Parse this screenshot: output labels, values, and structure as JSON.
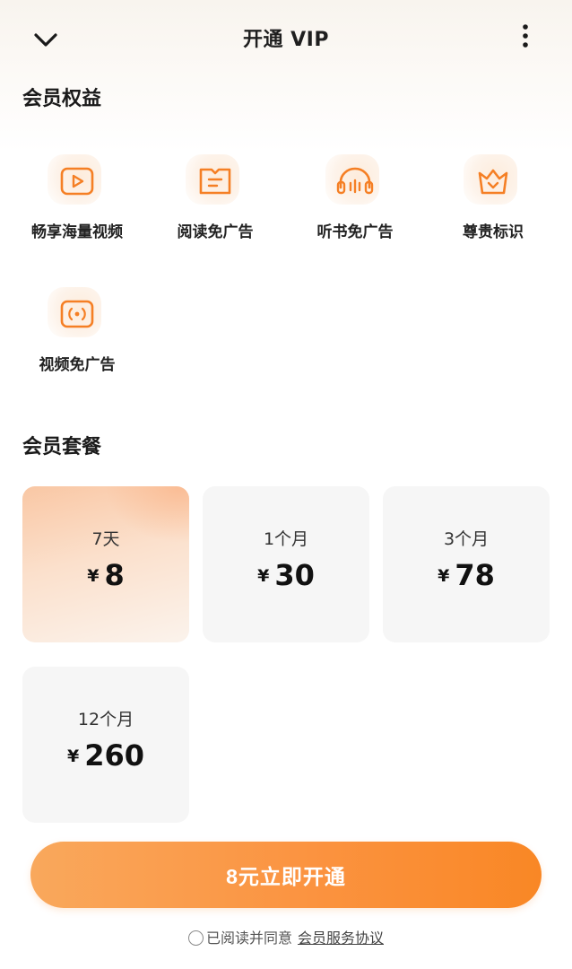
{
  "header": {
    "title": "开通 VIP",
    "back_icon": "chevron-down-icon",
    "more_icon": "more-vertical-icon"
  },
  "benefits": {
    "title": "会员权益",
    "items": [
      {
        "label": "畅享海量视频",
        "icon": "play-icon"
      },
      {
        "label": "阅读免广告",
        "icon": "book-icon"
      },
      {
        "label": "听书免广告",
        "icon": "headphones-icon"
      },
      {
        "label": "尊贵标识",
        "icon": "crown-icon"
      },
      {
        "label": "视频免广告",
        "icon": "broadcast-icon"
      }
    ]
  },
  "plans": {
    "title": "会员套餐",
    "currency": "¥",
    "items": [
      {
        "duration": "7天",
        "price": "8",
        "selected": true
      },
      {
        "duration": "1个月",
        "price": "30",
        "selected": false
      },
      {
        "duration": "3个月",
        "price": "78",
        "selected": false
      },
      {
        "duration": "12个月",
        "price": "260",
        "selected": false
      }
    ]
  },
  "cta": {
    "label": "8元立即开通"
  },
  "agreement": {
    "text": "已阅读并同意",
    "link": "会员服务协议"
  },
  "colors": {
    "accent": "#fb9340",
    "icon_orange": "#f57f24"
  }
}
